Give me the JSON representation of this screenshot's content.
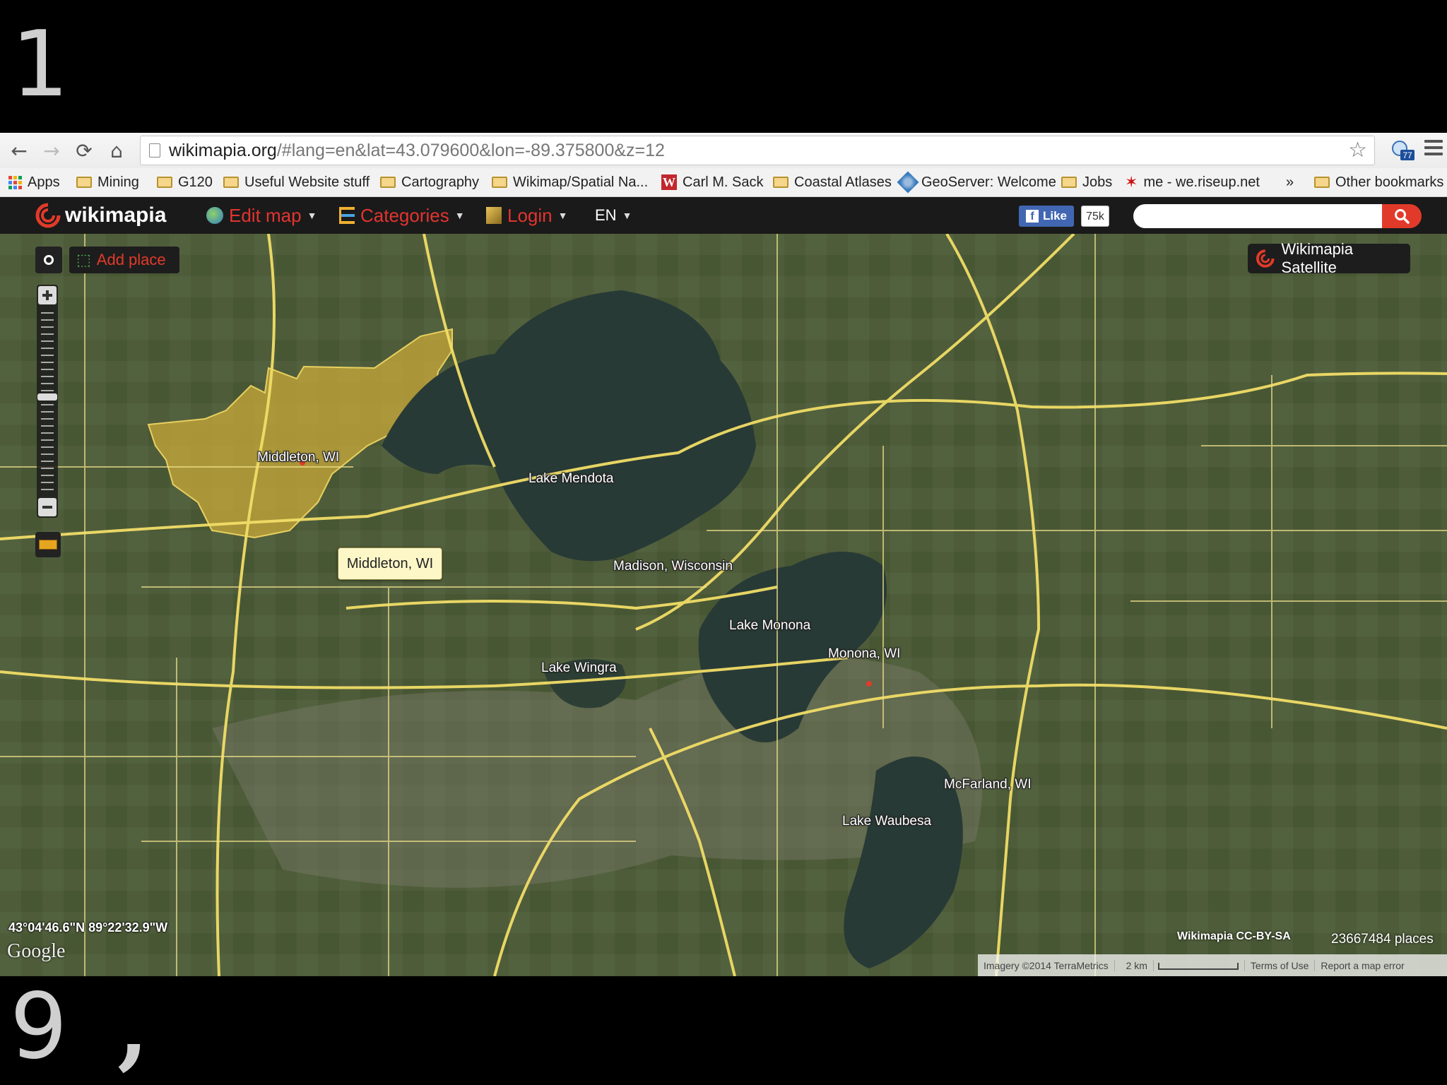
{
  "slide": {
    "top_number": "1",
    "bottom_number": "9",
    "bottom_mark": ","
  },
  "browser": {
    "url_domain": "wikimapia.org",
    "url_rest": "/#lang=en&lat=43.079600&lon=-89.375800&z=12",
    "extension_badge": "77",
    "bookmarks": [
      {
        "label": "Apps",
        "icon": "apps-grid-icon"
      },
      {
        "label": "Mining",
        "icon": "folder-icon"
      },
      {
        "label": "G120",
        "icon": "folder-icon"
      },
      {
        "label": "Useful Website stuff",
        "icon": "folder-icon"
      },
      {
        "label": "Cartography",
        "icon": "folder-icon"
      },
      {
        "label": "Wikimap/Spatial Na...",
        "icon": "folder-icon"
      },
      {
        "label": "Carl M. Sack",
        "icon": "w-logo-icon"
      },
      {
        "label": "Coastal Atlases",
        "icon": "folder-icon"
      },
      {
        "label": "GeoServer: Welcome",
        "icon": "geoserver-icon"
      },
      {
        "label": "Jobs",
        "icon": "folder-icon"
      },
      {
        "label": "me - we.riseup.net",
        "icon": "star-burst-icon"
      },
      {
        "label": "»",
        "icon": ""
      },
      {
        "label": "Other bookmarks",
        "icon": "folder-icon"
      }
    ]
  },
  "wikimapia": {
    "logo_text": "wikimapia",
    "menu": {
      "edit_map": "Edit map",
      "categories": "Categories",
      "login": "Login",
      "language": "EN"
    },
    "fb_like": "Like",
    "fb_count": "75k",
    "search_placeholder": ""
  },
  "map": {
    "add_place": "Add place",
    "layer_button": "Wikimapia Satellite",
    "tooltip": "Middleton, WI",
    "labels": {
      "middleton": "Middleton, WI",
      "lake_mendota": "Lake Mendota",
      "madison": "Madison, Wisconsin",
      "lake_monona": "Lake Monona",
      "monona": "Monona, WI",
      "lake_wingra": "Lake Wingra",
      "mcfarland": "McFarland, WI",
      "lake_waubesa": "Lake Waubesa"
    },
    "coordinates": "43°04'46.6\"N 89°22'32.9\"W",
    "google": "Google",
    "attribution": "Wikimapia CC-BY-SA",
    "places_count": "23667484 places",
    "footer": {
      "imagery": "Imagery ©2014 TerraMetrics",
      "scale": "2 km",
      "terms": "Terms of Use",
      "report": "Report a map error"
    },
    "colors": {
      "land": "#4c5a3a",
      "water": "#283a36",
      "road": "#f1dd67",
      "highlight": "#c9aa3a"
    }
  }
}
